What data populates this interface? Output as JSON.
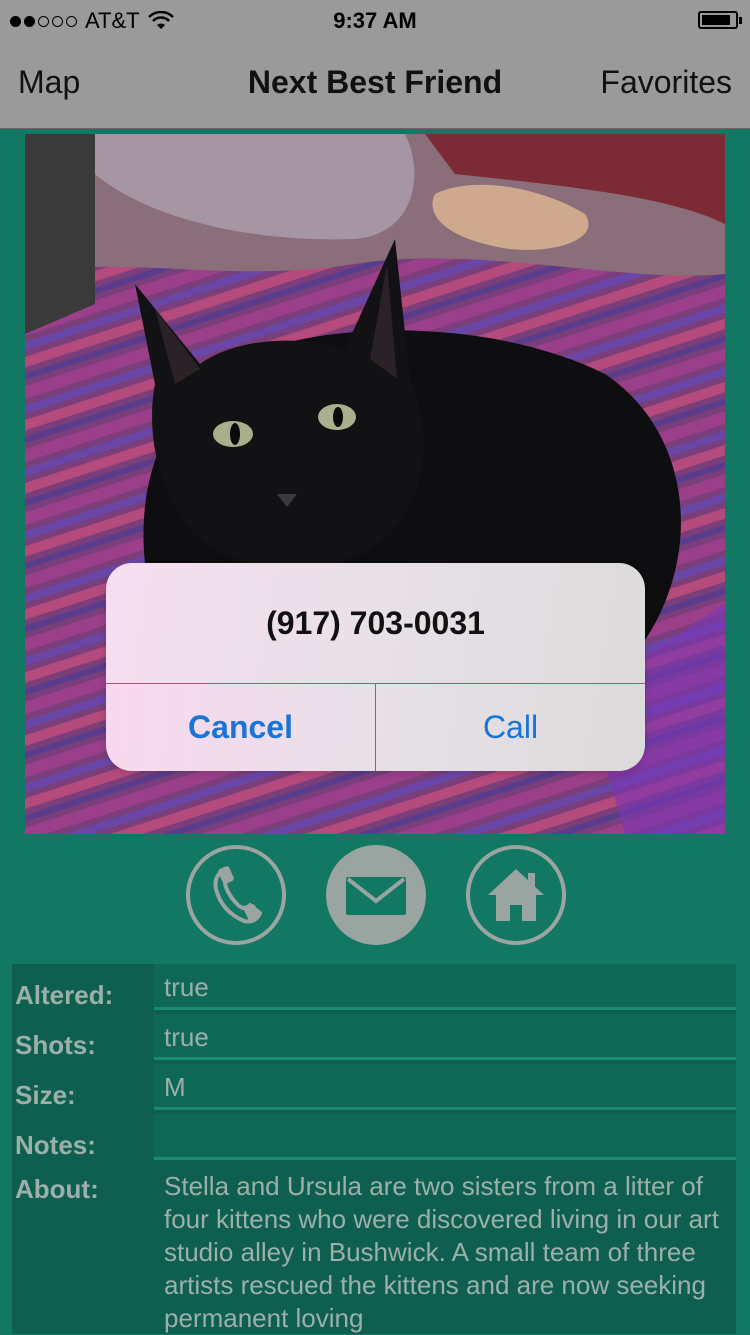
{
  "status_bar": {
    "carrier": "AT&T",
    "time": "9:37 AM",
    "signal_filled": 2,
    "signal_total": 5
  },
  "nav": {
    "left": "Map",
    "title": "Next Best Friend",
    "right": "Favorites"
  },
  "actions": {
    "icons": [
      "phone-icon",
      "mail-icon",
      "home-icon"
    ]
  },
  "details": {
    "altered_label": "Altered:",
    "altered_value": "true",
    "shots_label": "Shots:",
    "shots_value": "true",
    "size_label": "Size:",
    "size_value": "M",
    "notes_label": "Notes:",
    "notes_value": "",
    "about_label": "About:",
    "about_value": "Stella and Ursula are two sisters from a litter of four kittens who were discovered living in our art studio alley in Bushwick. A small team of three artists rescued the kittens and are now seeking permanent loving"
  },
  "alert": {
    "message": "(917) 703-0031",
    "cancel": "Cancel",
    "call": "Call"
  },
  "colors": {
    "background": "#127763",
    "nav_dimmed": "#9a9a9a",
    "alert_button": "#1a73d6"
  }
}
